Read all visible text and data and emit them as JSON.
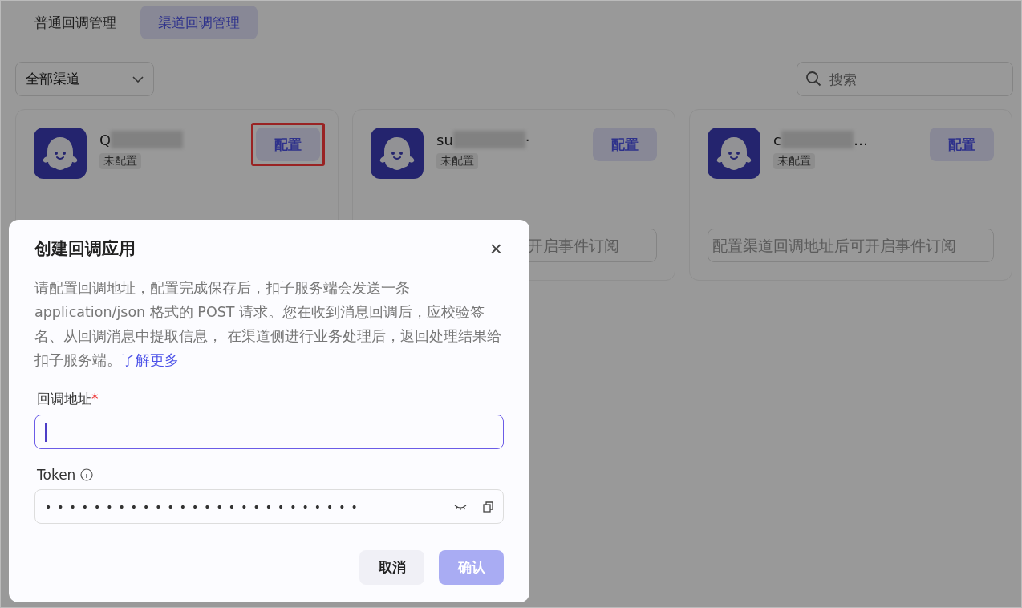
{
  "tabs": [
    {
      "label": "普通回调管理",
      "selected": false
    },
    {
      "label": "渠道回调管理",
      "selected": true
    }
  ],
  "filter": {
    "value": "全部渠道"
  },
  "search": {
    "placeholder": "搜索"
  },
  "cards": [
    {
      "name_start": "Q",
      "status": "未配置",
      "button": "配置",
      "highlighted": true
    },
    {
      "name_start": "su",
      "name_end": "·",
      "status": "未配置",
      "button": "配置",
      "highlighted": false,
      "field_placeholder": "开启事件订阅"
    },
    {
      "name_start": "c",
      "name_end": "…",
      "status": "未配置",
      "button": "配置",
      "highlighted": false,
      "field_placeholder": "配置渠道回调地址后可开启事件订阅"
    }
  ],
  "dialog": {
    "title": "创建回调应用",
    "close": "×",
    "description": "请配置回调地址，配置完成保存后，扣子服务端会发送一条 application/json 格式的 POST 请求。您在收到消息回调后，应校验签名、从回调消息中提取信息， 在渠道侧进行业务处理后，返回处理结果给扣子服务端。",
    "link": "了解更多",
    "fields": [
      {
        "kind": "url",
        "label": "回调地址",
        "required_mark": "*",
        "focused": true
      },
      {
        "kind": "token",
        "label": "Token",
        "focused": false,
        "value": "••••••••••••••••••••••••••"
      }
    ],
    "buttons": [
      {
        "label": "取消",
        "disabled": false,
        "kind": "secondary"
      },
      {
        "label": "确认",
        "disabled": true,
        "kind": "primary"
      }
    ]
  }
}
